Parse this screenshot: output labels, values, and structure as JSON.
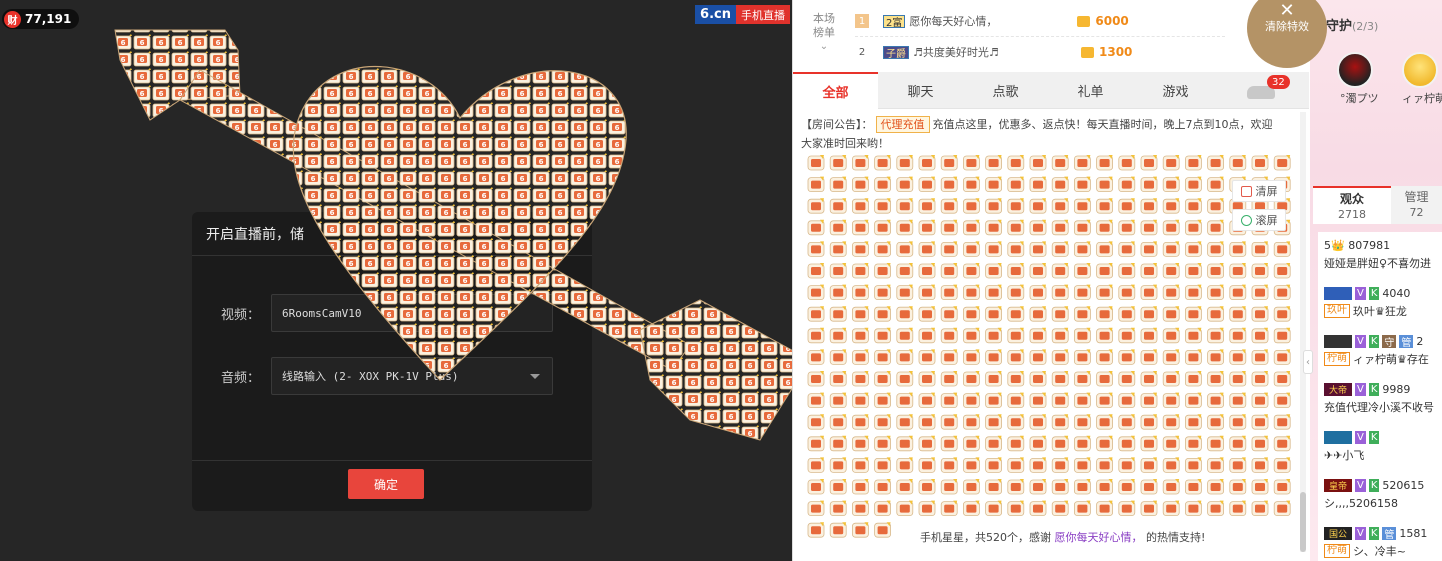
{
  "video": {
    "coin_icon_text": "财",
    "coin_count": "77,191",
    "logo_brand": "6.cn",
    "logo_mobile": "手机直播",
    "dialog": {
      "title": "开启直播前，储",
      "video_label": "视频：",
      "video_value": "6RoomsCamV10",
      "audio_label": "音频：",
      "audio_value": "线路输入 (2- XOX PK-1V Plus)",
      "confirm": "确定"
    }
  },
  "rank": {
    "title_line1": "本场",
    "title_line2": "榜单",
    "rows": [
      {
        "num": "1",
        "badge": "2富",
        "name": "愿你每天好心情，",
        "coins": "6000"
      },
      {
        "num": "2",
        "badge": "子爵",
        "name": "♬共度美好时光♬",
        "coins": "1300"
      }
    ]
  },
  "tabs": {
    "items": [
      "全部",
      "聊天",
      "点歌",
      "礼单",
      "游戏"
    ],
    "active": "全部",
    "car_count": "32"
  },
  "notice": {
    "prefix": "【房间公告】：",
    "tag": "代理充值",
    "text": "充值点这里，优惠多、返点快！每天直播时间，晚上7点到10点，欢迎大家准时回来哟！"
  },
  "gift_msg": {
    "text1": "手机星星，共520个，感谢",
    "highlight": "愿你每天好心情，",
    "text2": "的热情支持!"
  },
  "float_buttons": {
    "clear": "清屏",
    "scroll": "滚屏"
  },
  "special": {
    "close_glyph": "✕",
    "label": "清除特效"
  },
  "guard": {
    "title": "守护",
    "count": "(2/3)",
    "names": [
      "°濁プツ",
      "ィァ柠萌"
    ]
  },
  "audience_tabs": {
    "viewers_label": "观众",
    "viewers_count": "2718",
    "admin_label": "管理",
    "admin_count": "72"
  },
  "audience": [
    {
      "top": "5👑 807981",
      "name": "娅娅是胖妞♀不喜勿进"
    },
    {
      "top": "4040",
      "fan": "玖叶",
      "name": "玖叶♛狂龙"
    },
    {
      "top": "2",
      "fan": "柠萌",
      "name": "ィァ柠萌♛存在"
    },
    {
      "top": "9989",
      "avatar": "大帝",
      "name": "充值代理冷小溪不收号"
    },
    {
      "top": "",
      "name": "✈✈小飞"
    },
    {
      "top": "520615",
      "avatar": "皇帝",
      "name": "シ,,,,5206158"
    },
    {
      "top": "1581",
      "avatar": "国公",
      "fan": "柠萌",
      "name": "シ、冷丰~"
    }
  ],
  "colors": {
    "accent": "#e8322a",
    "gift_gold": "#f08a18",
    "video_bg": "#262626",
    "special_btn": "#b49366"
  },
  "icons": [
    "coin-icon",
    "car-icon",
    "trash-icon",
    "check-icon",
    "crown-icon",
    "close-icon",
    "chevron-left-icon"
  ]
}
